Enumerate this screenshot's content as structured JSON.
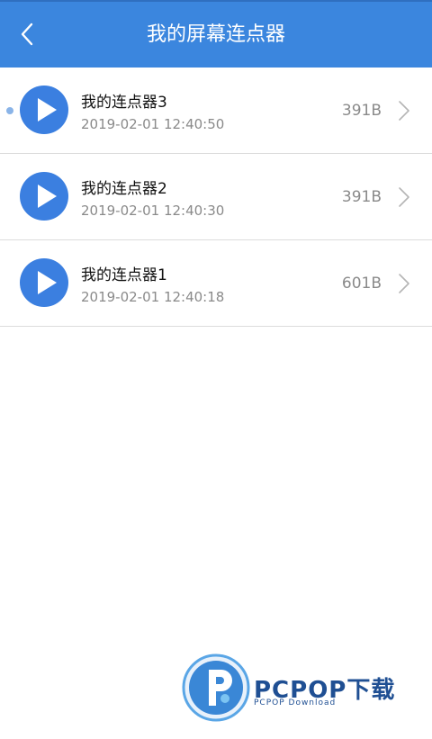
{
  "header": {
    "title": "我的屏幕连点器",
    "back_icon": "chevron-left-icon",
    "bg_color": "#3b86de"
  },
  "items": [
    {
      "name": "我的连点器3",
      "time": "2019-02-01 12:40:50",
      "size": "391B",
      "active": true
    },
    {
      "name": "我的连点器2",
      "time": "2019-02-01 12:40:30",
      "size": "391B",
      "active": false
    },
    {
      "name": "我的连点器1",
      "time": "2019-02-01 12:40:18",
      "size": "601B",
      "active": false
    }
  ],
  "watermark": {
    "brand": "PCPOP下载",
    "sub": "PCPOP Download"
  },
  "colors": {
    "accent": "#3b86de",
    "play_icon": "#3b7fe0"
  }
}
